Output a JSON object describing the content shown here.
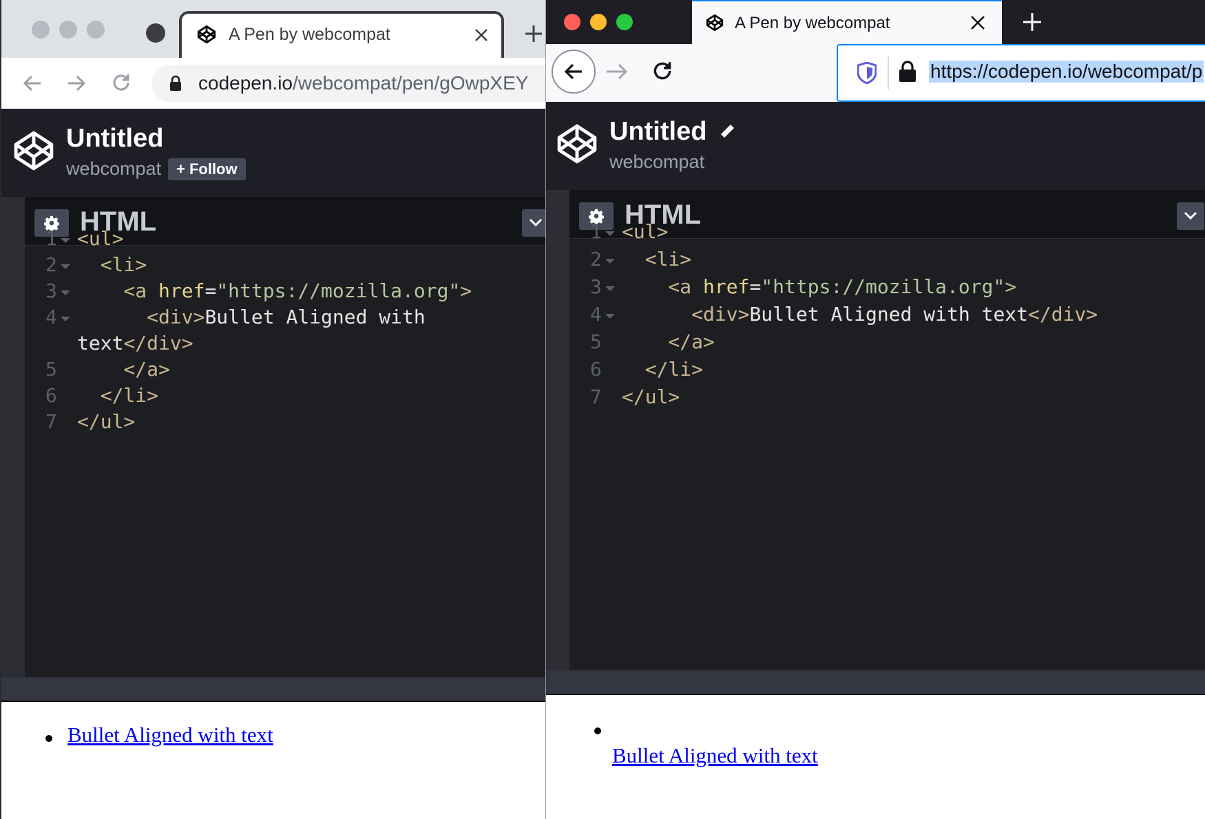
{
  "left_window": {
    "tab_title": "A Pen by webcompat",
    "url_domain": "codepen.io",
    "url_path": "/webcompat/pen/gOwpXEY",
    "pen": {
      "title": "Untitled",
      "user": "webcompat",
      "follow_label": "+ Follow"
    },
    "editor": {
      "title": "HTML",
      "lines": [
        {
          "n": "1",
          "parts": [
            {
              "c": "tag",
              "t": "<ul>"
            }
          ]
        },
        {
          "n": "2",
          "parts": [
            {
              "c": "tag",
              "t": "  <li>"
            }
          ]
        },
        {
          "n": "3",
          "parts": [
            {
              "c": "tag",
              "t": "    <a "
            },
            {
              "c": "attr",
              "t": "href"
            },
            {
              "c": "txt",
              "t": "="
            },
            {
              "c": "str",
              "t": "\"https://mozilla.org\""
            },
            {
              "c": "tag",
              "t": ">"
            }
          ]
        },
        {
          "n": "4",
          "parts": [
            {
              "c": "tag",
              "t": "      <div>"
            },
            {
              "c": "txt",
              "t": "Bullet Aligned with"
            }
          ]
        },
        {
          "n": "",
          "parts": [
            {
              "c": "txt",
              "t": "text"
            },
            {
              "c": "tag",
              "t": "</div>"
            }
          ]
        },
        {
          "n": "5",
          "parts": [
            {
              "c": "tag",
              "t": "    </a>"
            }
          ]
        },
        {
          "n": "6",
          "parts": [
            {
              "c": "tag",
              "t": "  </li>"
            }
          ]
        },
        {
          "n": "7",
          "parts": [
            {
              "c": "tag",
              "t": "</ul>"
            }
          ]
        }
      ]
    },
    "preview_link": "Bullet Aligned with text"
  },
  "right_window": {
    "tab_title": "A Pen by webcompat",
    "url": "https://codepen.io/webcompat/p",
    "pen": {
      "title": "Untitled",
      "user": "webcompat"
    },
    "editor": {
      "title": "HTML",
      "lines": [
        {
          "n": "1",
          "parts": [
            {
              "c": "tag",
              "t": "<ul>"
            }
          ]
        },
        {
          "n": "2",
          "parts": [
            {
              "c": "tag",
              "t": "  <li>"
            }
          ]
        },
        {
          "n": "3",
          "parts": [
            {
              "c": "tag",
              "t": "    <a "
            },
            {
              "c": "attr",
              "t": "href"
            },
            {
              "c": "txt",
              "t": "="
            },
            {
              "c": "str",
              "t": "\"https://mozilla.org\""
            },
            {
              "c": "tag",
              "t": ">"
            }
          ]
        },
        {
          "n": "4",
          "parts": [
            {
              "c": "tag",
              "t": "      <div>"
            },
            {
              "c": "txt",
              "t": "Bullet Aligned with text"
            },
            {
              "c": "tag",
              "t": "</div>"
            }
          ]
        },
        {
          "n": "5",
          "parts": [
            {
              "c": "tag",
              "t": "    </a>"
            }
          ]
        },
        {
          "n": "6",
          "parts": [
            {
              "c": "tag",
              "t": "  </li>"
            }
          ]
        },
        {
          "n": "7",
          "parts": [
            {
              "c": "tag",
              "t": "</ul>"
            }
          ]
        }
      ]
    },
    "preview_link": "Bullet Aligned with text"
  },
  "colors": {
    "codepen_bg": "#1e1f26",
    "editor_bg": "#1d1e22",
    "tag": "#c8b68e",
    "attr": "#e6d48c",
    "string": "#b8c49c",
    "link": "#0000ee",
    "firefox_focus": "#0a84ff",
    "mac_close": "#ff5f57",
    "mac_min": "#febc2e",
    "mac_max": "#28c840"
  }
}
